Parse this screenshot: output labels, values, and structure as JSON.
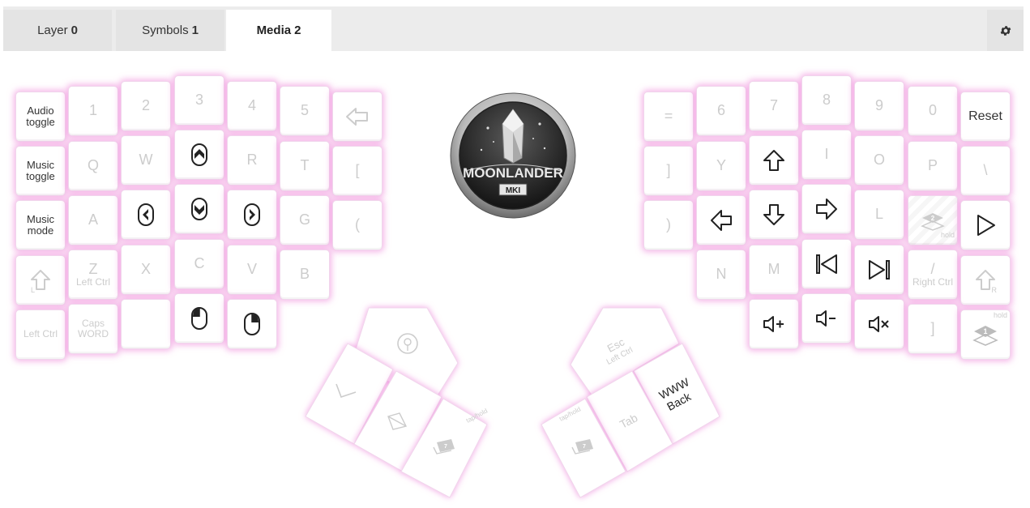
{
  "tabs": [
    {
      "name": "Layer",
      "num": "0"
    },
    {
      "name": "Symbols",
      "num": "1"
    },
    {
      "name": "Media",
      "num": "2"
    }
  ],
  "logo": {
    "line1": "MOONLANDER",
    "line2": "MKI"
  },
  "keys": {
    "audio_toggle": "Audio toggle",
    "music_toggle": "Music toggle",
    "music_mode": "Music mode",
    "l_1": "1",
    "l_2": "2",
    "l_3": "3",
    "l_4": "4",
    "l_5": "5",
    "l_q": "Q",
    "l_w": "W",
    "l_r": "R",
    "l_t": "T",
    "l_lbracket": "[",
    "l_a": "A",
    "l_g": "G",
    "l_lparen": "(",
    "l_shift_sub": "L",
    "l_z": "Z",
    "l_z_sub": "Left Ctrl",
    "l_x": "X",
    "l_c": "C",
    "l_v": "V",
    "l_b": "B",
    "left_ctrl": "Left Ctrl",
    "caps_word_1": "Caps",
    "caps_word_2": "WORD",
    "r_eq": "=",
    "r_6": "6",
    "r_7": "7",
    "r_8": "8",
    "r_9": "9",
    "r_0": "0",
    "reset": "Reset",
    "r_rbracket": "]",
    "r_y": "Y",
    "r_i": "I",
    "r_o": "O",
    "r_p": "P",
    "r_bslash": "\\",
    "r_rparen": ")",
    "r_l": "L",
    "r_n": "N",
    "r_m": "M",
    "r_slash": "/",
    "r_slash_sub": "Right Ctrl",
    "r_shift_sub": "R",
    "r_rbracket2": "]",
    "hold": "hold",
    "layer_2": "2",
    "layer_1": "1",
    "esc": "Esc",
    "esc_sub": "Left Ctrl",
    "tab": "Tab",
    "www_back_1": "WWW",
    "www_back_2": "Back",
    "tap_hold": "tap/hold",
    "layer_7": "7"
  },
  "colors": {
    "glow": "#ec78d6",
    "accent": "#333333"
  }
}
